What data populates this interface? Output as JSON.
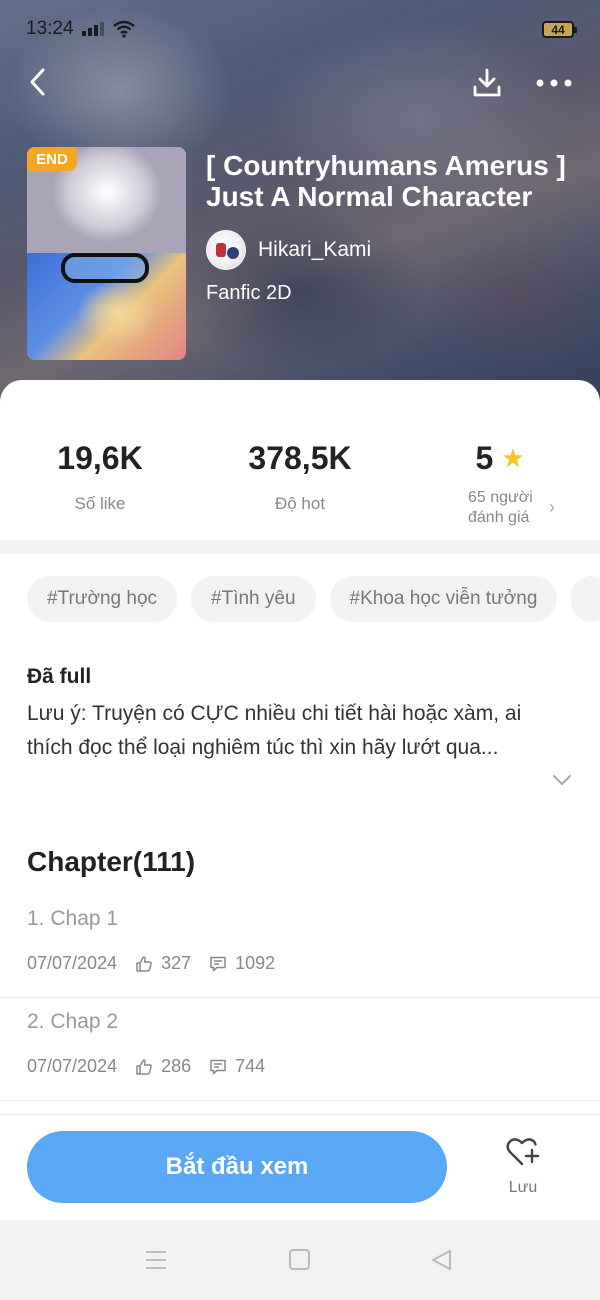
{
  "status_bar": {
    "time": "13:24",
    "battery": "44"
  },
  "story": {
    "badge": "END",
    "title": "[ Countryhumans Amerus ] Just A Normal Character",
    "author": "Hikari_Kami",
    "genre": "Fanfic 2D"
  },
  "stats": {
    "likes": {
      "value": "19,6K",
      "label": "Số like"
    },
    "hot": {
      "value": "378,5K",
      "label": "Độ hot"
    },
    "rating": {
      "value": "5",
      "label_line1": "65 người",
      "label_line2": "đánh giá"
    }
  },
  "tags": [
    "#Trường học",
    "#Tình yêu",
    "#Khoa học viễn tưởng"
  ],
  "description": {
    "status": "Đã full",
    "text": "Lưu ý: Truyện có CỰC nhiều chi tiết hài hoặc xàm, ai thích đọc thể loại nghiêm túc thì xin hãy lướt qua..."
  },
  "chapters": {
    "heading": "Chapter(111)",
    "items": [
      {
        "title": "1. Chap 1",
        "date": "07/07/2024",
        "likes": "327",
        "comments": "1092"
      },
      {
        "title": "2. Chap 2",
        "date": "07/07/2024",
        "likes": "286",
        "comments": "744"
      }
    ]
  },
  "actions": {
    "start": "Bắt đầu xem",
    "save": "Lưu"
  },
  "colors": {
    "accent": "#5aa7f5",
    "badge": "#f5a623",
    "star": "#f8c31b"
  },
  "icons": [
    "back-arrow-icon",
    "download-icon",
    "more-icon",
    "star-icon",
    "chevron-right-icon",
    "chevron-down-icon",
    "like-icon",
    "comment-icon",
    "heart-plus-icon"
  ]
}
